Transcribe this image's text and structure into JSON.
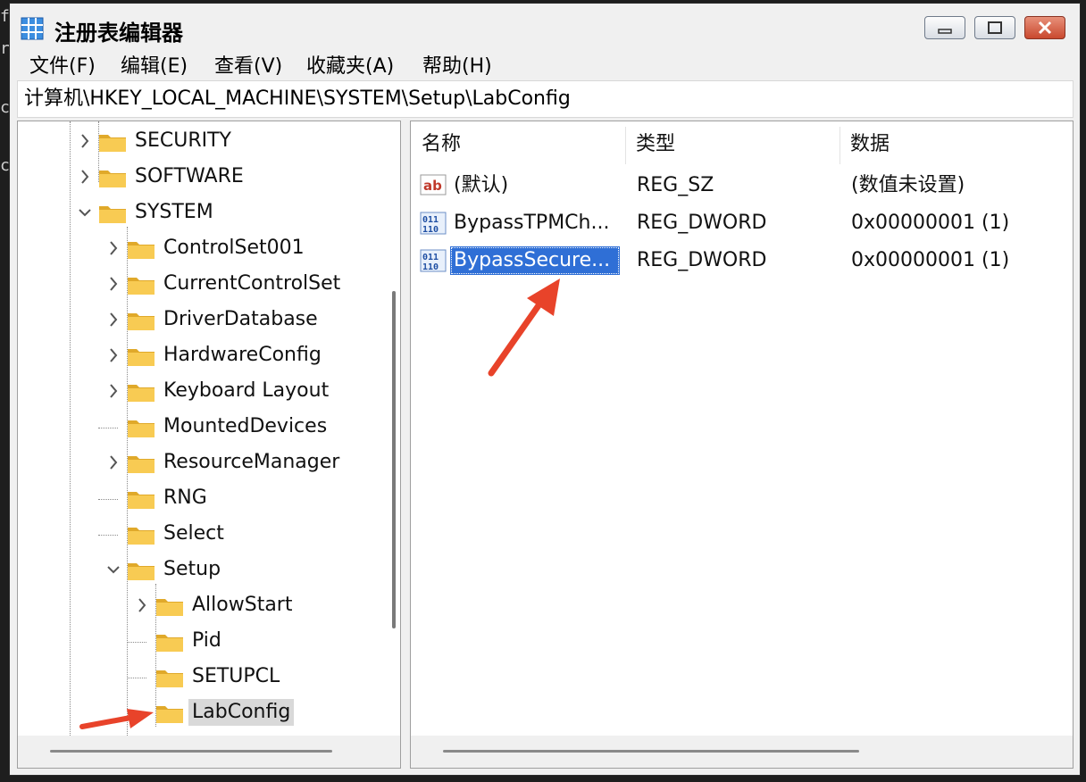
{
  "background_text": [
    "f",
    "r",
    "c",
    "c"
  ],
  "window": {
    "title": "注册表编辑器",
    "menu": [
      "文件(F)",
      "编辑(E)",
      "查看(V)",
      "收藏夹(A)",
      "帮助(H)"
    ],
    "address": "计算机\\HKEY_LOCAL_MACHINE\\SYSTEM\\Setup\\LabConfig"
  },
  "tree": {
    "items": [
      {
        "label": "SECURITY",
        "level": 0,
        "chevron": "right"
      },
      {
        "label": "SOFTWARE",
        "level": 0,
        "chevron": "right"
      },
      {
        "label": "SYSTEM",
        "level": 0,
        "chevron": "down"
      },
      {
        "label": "ControlSet001",
        "level": 1,
        "chevron": "right"
      },
      {
        "label": "CurrentControlSet",
        "level": 1,
        "chevron": "right"
      },
      {
        "label": "DriverDatabase",
        "level": 1,
        "chevron": "right"
      },
      {
        "label": "HardwareConfig",
        "level": 1,
        "chevron": "right"
      },
      {
        "label": "Keyboard Layout",
        "level": 1,
        "chevron": "right"
      },
      {
        "label": "MountedDevices",
        "level": 1,
        "chevron": "none"
      },
      {
        "label": "ResourceManager",
        "level": 1,
        "chevron": "right"
      },
      {
        "label": "RNG",
        "level": 1,
        "chevron": "none"
      },
      {
        "label": "Select",
        "level": 1,
        "chevron": "none"
      },
      {
        "label": "Setup",
        "level": 1,
        "chevron": "down"
      },
      {
        "label": "AllowStart",
        "level": 2,
        "chevron": "right"
      },
      {
        "label": "Pid",
        "level": 2,
        "chevron": "none"
      },
      {
        "label": "SETUPCL",
        "level": 2,
        "chevron": "none"
      },
      {
        "label": "LabConfig",
        "level": 2,
        "chevron": "none",
        "selected": true
      }
    ]
  },
  "list": {
    "headers": {
      "name": "名称",
      "type": "类型",
      "data": "数据"
    },
    "rows": [
      {
        "icon": "string-value-icon",
        "name": "(默认)",
        "type": "REG_SZ",
        "data": "(数值未设置)"
      },
      {
        "icon": "dword-value-icon",
        "name": "BypassTPMCh...",
        "type": "REG_DWORD",
        "data": "0x00000001 (1)"
      },
      {
        "icon": "dword-value-icon",
        "name": "BypassSecure...",
        "type": "REG_DWORD",
        "data": "0x00000001 (1)",
        "selected": true
      }
    ]
  },
  "colors": {
    "accent": "#2f6fd6",
    "arrow": "#e8432a",
    "folder": "#f5c242"
  }
}
